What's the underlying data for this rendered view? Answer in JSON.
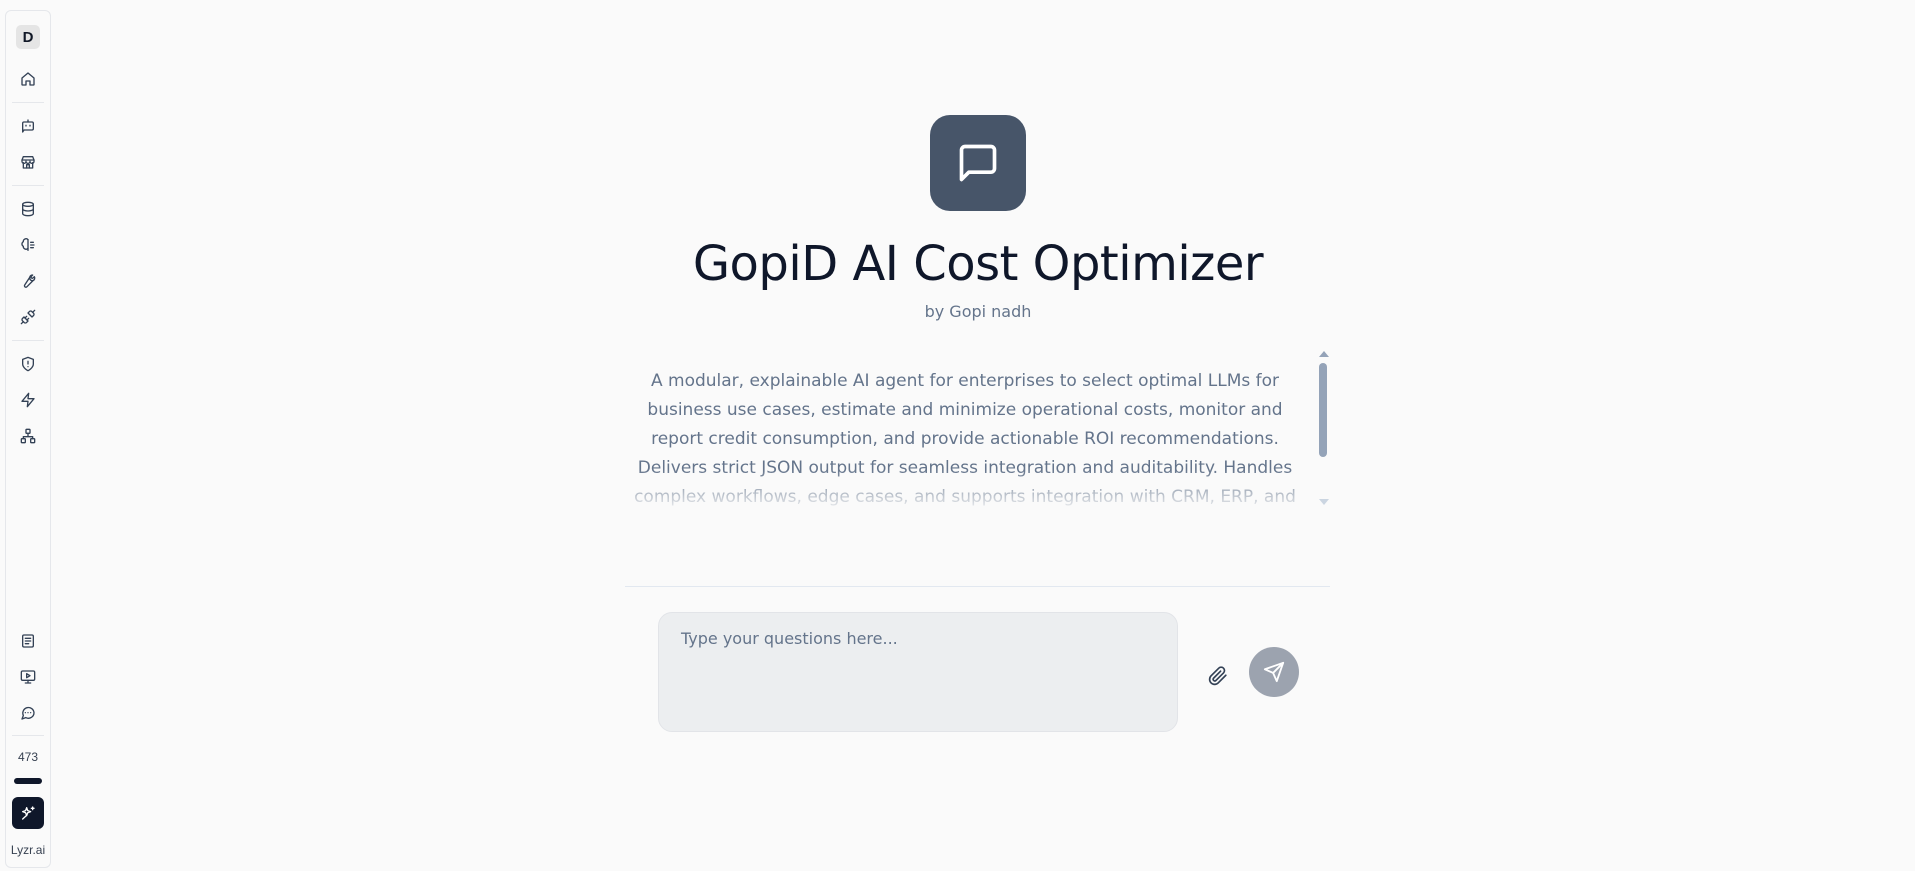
{
  "sidebar": {
    "avatar_initial": "D",
    "top_icons": [
      {
        "name": "home-icon"
      },
      {
        "name": "bot-icon"
      },
      {
        "name": "store-icon"
      },
      {
        "name": "database-icon"
      },
      {
        "name": "brain-icon"
      },
      {
        "name": "wrench-icon"
      },
      {
        "name": "plug-icon"
      },
      {
        "name": "shield-icon"
      },
      {
        "name": "lightning-icon"
      },
      {
        "name": "network-icon"
      }
    ],
    "bottom_icons": [
      {
        "name": "document-icon"
      },
      {
        "name": "presentation-icon"
      },
      {
        "name": "message-circle-icon"
      }
    ],
    "credits": "473",
    "brand": "Lyzr.ai"
  },
  "agent": {
    "icon": "message-square-icon",
    "title": "GopiD AI Cost Optimizer",
    "byline": "by Gopi nadh",
    "description": "A modular, explainable AI agent for enterprises to select optimal LLMs for business use cases, estimate and minimize operational costs, monitor and report credit consumption, and provide actionable ROI recommendations. Delivers strict JSON output for seamless integration and auditability. Handles complex workflows, edge cases, and supports integration with CRM, ERP, and"
  },
  "chat": {
    "placeholder": "Type your questions here...",
    "attach_icon": "paperclip-icon",
    "send_icon": "send-icon"
  },
  "colors": {
    "background": "#fafafa",
    "agent_icon_bg": "#475569",
    "send_button_bg": "#9ca3af",
    "dark": "#0f172a",
    "muted_text": "#64748b"
  }
}
